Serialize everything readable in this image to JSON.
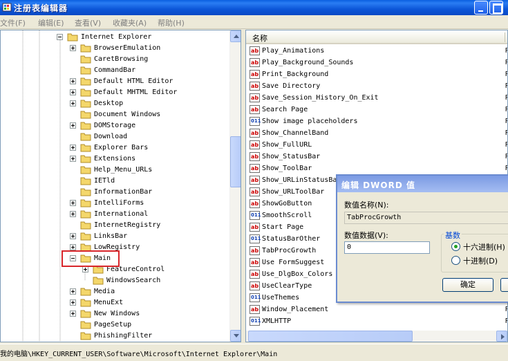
{
  "window": {
    "title": "注册表编辑器"
  },
  "menu": [
    "文件(F)",
    "编辑(E)",
    "查看(V)",
    "收藏夹(A)",
    "帮助(H)"
  ],
  "tree": {
    "root": "Internet Explorer",
    "items": [
      {
        "label": "BrowserEmulation",
        "expandable": true
      },
      {
        "label": "CaretBrowsing",
        "expandable": false
      },
      {
        "label": "CommandBar",
        "expandable": false
      },
      {
        "label": "Default HTML Editor",
        "expandable": true
      },
      {
        "label": "Default MHTML Editor",
        "expandable": true
      },
      {
        "label": "Desktop",
        "expandable": true
      },
      {
        "label": "Document Windows",
        "expandable": false
      },
      {
        "label": "DOMStorage",
        "expandable": true
      },
      {
        "label": "Download",
        "expandable": false
      },
      {
        "label": "Explorer Bars",
        "expandable": true
      },
      {
        "label": "Extensions",
        "expandable": true
      },
      {
        "label": "Help_Menu_URLs",
        "expandable": false
      },
      {
        "label": "IETld",
        "expandable": false
      },
      {
        "label": "InformationBar",
        "expandable": false
      },
      {
        "label": "IntelliForms",
        "expandable": true
      },
      {
        "label": "International",
        "expandable": true
      },
      {
        "label": "InternetRegistry",
        "expandable": false
      },
      {
        "label": "LinksBar",
        "expandable": true
      },
      {
        "label": "LowRegistry",
        "expandable": true
      },
      {
        "label": "Main",
        "expandable": true,
        "expanded": true
      },
      {
        "label": "FeatureControl",
        "expandable": true,
        "child": true
      },
      {
        "label": "WindowsSearch",
        "expandable": false,
        "child": true
      },
      {
        "label": "Media",
        "expandable": true
      },
      {
        "label": "MenuExt",
        "expandable": true
      },
      {
        "label": "New Windows",
        "expandable": true
      },
      {
        "label": "PageSetup",
        "expandable": false
      },
      {
        "label": "PhishingFilter",
        "expandable": false
      }
    ]
  },
  "list": {
    "header_name": "名称",
    "type_stub": "R",
    "items": [
      {
        "name": "Play_Animations",
        "icon": "ab"
      },
      {
        "name": "Play_Background_Sounds",
        "icon": "ab"
      },
      {
        "name": "Print_Background",
        "icon": "ab"
      },
      {
        "name": "Save Directory",
        "icon": "ab"
      },
      {
        "name": "Save_Session_History_On_Exit",
        "icon": "ab"
      },
      {
        "name": "Search Page",
        "icon": "ab"
      },
      {
        "name": "Show image placeholders",
        "icon": "bin"
      },
      {
        "name": "Show_ChannelBand",
        "icon": "ab"
      },
      {
        "name": "Show_FullURL",
        "icon": "ab"
      },
      {
        "name": "Show_StatusBar",
        "icon": "ab"
      },
      {
        "name": "Show_ToolBar",
        "icon": "ab"
      },
      {
        "name": "Show_URLinStatusBar",
        "icon": "ab"
      },
      {
        "name": "Show_URLToolBar",
        "icon": "ab"
      },
      {
        "name": "ShowGoButton",
        "icon": "ab"
      },
      {
        "name": "SmoothScroll",
        "icon": "bin"
      },
      {
        "name": "Start Page",
        "icon": "ab"
      },
      {
        "name": "StatusBarOther",
        "icon": "bin"
      },
      {
        "name": "TabProcGrowth",
        "icon": "ab"
      },
      {
        "name": "Use FormSuggest",
        "icon": "ab"
      },
      {
        "name": "Use_DlgBox_Colors",
        "icon": "ab"
      },
      {
        "name": "UseClearType",
        "icon": "ab"
      },
      {
        "name": "UseThemes",
        "icon": "bin"
      },
      {
        "name": "Window_Placement",
        "icon": "ab"
      },
      {
        "name": "XMLHTTP",
        "icon": "bin"
      }
    ]
  },
  "status_path": "我的电脑\\HKEY_CURRENT_USER\\Software\\Microsoft\\Internet Explorer\\Main",
  "dialog": {
    "title": "编辑 DWORD 值",
    "name_label": "数值名称(N):",
    "name_value": "TabProcGrowth",
    "data_label": "数值数据(V):",
    "data_value": "0",
    "base_title": "基数",
    "hex_label": "十六进制(H)",
    "dec_label": "十进制(D)",
    "ok_label": "确定"
  },
  "colors": {
    "titlebar": "#0a5fe0",
    "highlight": "#d8262b",
    "folder": "#f4d76b"
  }
}
